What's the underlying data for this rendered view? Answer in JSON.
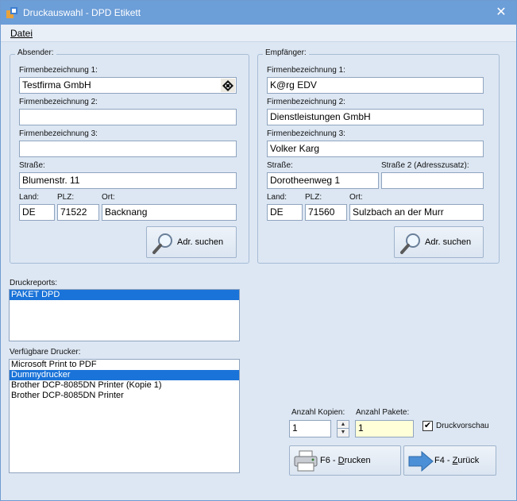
{
  "window": {
    "title": "Druckauswahl - DPD Etikett",
    "close_glyph": "✕"
  },
  "menu": {
    "file": "Datei"
  },
  "sender": {
    "legend": "Absender:",
    "company1_label": "Firmenbezeichnung 1:",
    "company1_value": "Testfirma GmbH",
    "company2_label": "Firmenbezeichnung 2:",
    "company2_value": "",
    "company3_label": "Firmenbezeichnung 3:",
    "company3_value": "",
    "street_label": "Straße:",
    "street_value": "Blumenstr. 11",
    "country_label": "Land:",
    "country_value": "DE",
    "zip_label": "PLZ:",
    "zip_value": "71522",
    "city_label": "Ort:",
    "city_value": "Backnang",
    "search_button": "Adr. suchen"
  },
  "recipient": {
    "legend": "Empfänger:",
    "company1_label": "Firmenbezeichnung 1:",
    "company1_value": "K@rg EDV",
    "company2_label": "Firmenbezeichnung 2:",
    "company2_value": "Dienstleistungen GmbH",
    "company3_label": "Firmenbezeichnung 3:",
    "company3_value": "Volker Karg",
    "street_label": "Straße:",
    "street_value": "Dorotheenweg 1",
    "street2_label": "Straße 2 (Adresszusatz):",
    "street2_value": "",
    "country_label": "Land:",
    "country_value": "DE",
    "zip_label": "PLZ:",
    "zip_value": "71560",
    "city_label": "Ort:",
    "city_value": "Sulzbach an der Murr",
    "search_button": "Adr. suchen"
  },
  "reports": {
    "label": "Druckreports:",
    "items": [
      "PAKET DPD"
    ]
  },
  "printers": {
    "label": "Verfügbare Drucker:",
    "items": [
      "Microsoft Print to PDF",
      "Dummydrucker",
      "Brother DCP-8085DN Printer (Kopie 1)",
      "Brother DCP-8085DN Printer"
    ]
  },
  "options": {
    "copies_label": "Anzahl Kopien:",
    "copies_value": "1",
    "packages_label": "Anzahl Pakete:",
    "packages_value": "1",
    "preview_label": "Druckvorschau",
    "preview_checked": true,
    "preview_check_glyph": "✔"
  },
  "actions": {
    "print_prefix": "F6 - ",
    "print_underlined": "D",
    "print_rest": "rucken",
    "back_prefix": "F4 - ",
    "back_underlined": "Z",
    "back_rest": "urück"
  },
  "colors": {
    "titlebar": "#6c9ed8",
    "selection": "#1a73d8",
    "window_bg": "#dde7f3",
    "packages_field": "#ffffd8"
  }
}
